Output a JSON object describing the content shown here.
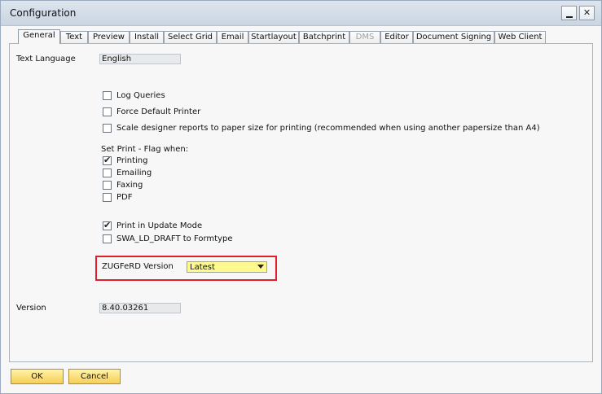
{
  "window": {
    "title": "Configuration",
    "minimize_icon": "minimize-icon",
    "close_icon": "close-icon",
    "close_glyph": "✕"
  },
  "tabs": [
    {
      "label": "General",
      "active": true,
      "disabled": false
    },
    {
      "label": "Text",
      "active": false,
      "disabled": false
    },
    {
      "label": "Preview",
      "active": false,
      "disabled": false
    },
    {
      "label": "Install",
      "active": false,
      "disabled": false
    },
    {
      "label": "Select Grid",
      "active": false,
      "disabled": false
    },
    {
      "label": "Email",
      "active": false,
      "disabled": false
    },
    {
      "label": "Startlayout",
      "active": false,
      "disabled": false
    },
    {
      "label": "Batchprint",
      "active": false,
      "disabled": false
    },
    {
      "label": "DMS",
      "active": false,
      "disabled": true
    },
    {
      "label": "Editor",
      "active": false,
      "disabled": false
    },
    {
      "label": "Document Signing",
      "active": false,
      "disabled": false
    },
    {
      "label": "Web Client",
      "active": false,
      "disabled": false
    }
  ],
  "general": {
    "text_language_label": "Text Language",
    "text_language_value": "English",
    "options": [
      {
        "label": "Log Queries",
        "checked": false
      },
      {
        "label": "Force Default Printer",
        "checked": false
      },
      {
        "label": "Scale designer reports to paper size for printing (recommended when using another papersize than A4)",
        "checked": false
      }
    ],
    "set_print_flag_label": "Set Print - Flag when:",
    "print_flags": [
      {
        "label": "Printing",
        "checked": true
      },
      {
        "label": "Emailing",
        "checked": false
      },
      {
        "label": "Faxing",
        "checked": false
      },
      {
        "label": "PDF",
        "checked": false
      }
    ],
    "update_options": [
      {
        "label": "Print in Update Mode",
        "checked": true
      },
      {
        "label": "SWA_LD_DRAFT to Formtype",
        "checked": false
      }
    ],
    "zugferd_label": "ZUGFeRD Version",
    "zugferd_value": "Latest",
    "version_label": "Version",
    "version_value": "8.40.03261"
  },
  "buttons": {
    "ok": "OK",
    "cancel": "Cancel"
  },
  "colors": {
    "highlight_border": "#e0202a",
    "select_background": "#fdf98f",
    "button_gold": "#f6cf57"
  },
  "check_glyph": "✔"
}
